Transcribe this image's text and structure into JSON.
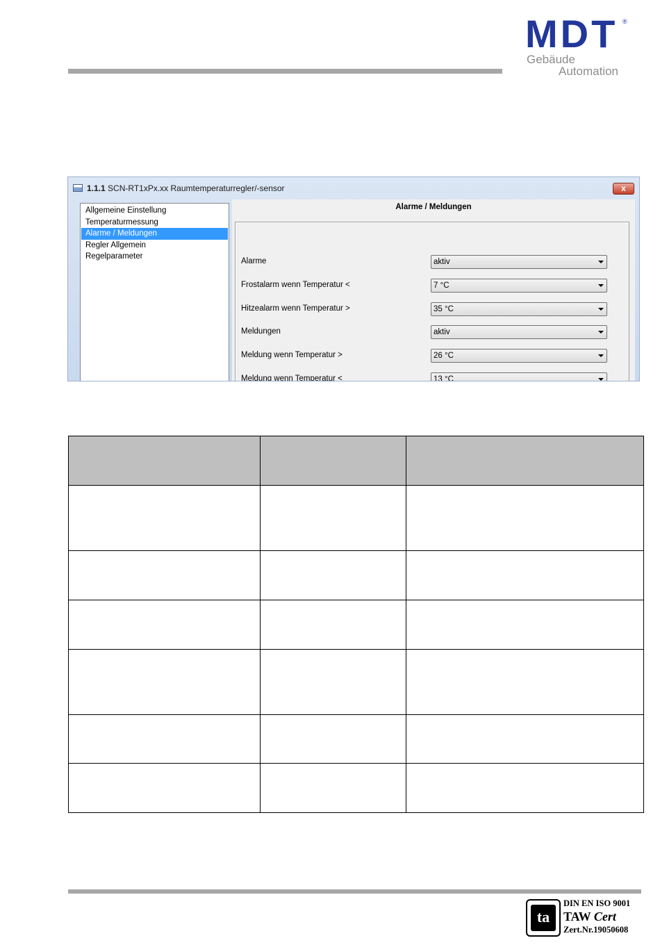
{
  "header": {
    "logo": {
      "mark": "MDT",
      "registered": "®",
      "line1": "Gebäude",
      "line2": "Automation"
    }
  },
  "dialog": {
    "title_number": "1.1.1",
    "title_text": " SCN-RT1xPx.xx Raumtemperaturregler/-sensor",
    "close_symbol": "x",
    "tree_items": [
      {
        "label": "Allgemeine Einstellung",
        "selected": false
      },
      {
        "label": "Temperaturmessung",
        "selected": false
      },
      {
        "label": "Alarme / Meldungen",
        "selected": true
      },
      {
        "label": "Regler Allgemein",
        "selected": false
      },
      {
        "label": "Regelparameter",
        "selected": false
      }
    ],
    "panel_title": "Alarme / Meldungen",
    "params": [
      {
        "label": "Alarme",
        "value": "aktiv"
      },
      {
        "label": "Frostalarm wenn Temperatur <",
        "value": "7 °C"
      },
      {
        "label": "Hitzealarm wenn Temperatur >",
        "value": "35 °C"
      },
      {
        "label": "Meldungen",
        "value": "aktiv"
      },
      {
        "label": "Meldung wenn Temperatur >",
        "value": "26 °C"
      },
      {
        "label": "Meldung wenn Temperatur <",
        "value": "13 °C"
      }
    ]
  },
  "footer": {
    "cert_logo": "ta",
    "cert_line1": "DIN EN ISO 9001",
    "cert_line2a": "TAW ",
    "cert_line2b": "Cert",
    "cert_line3": "Zert.Nr.19050608"
  }
}
